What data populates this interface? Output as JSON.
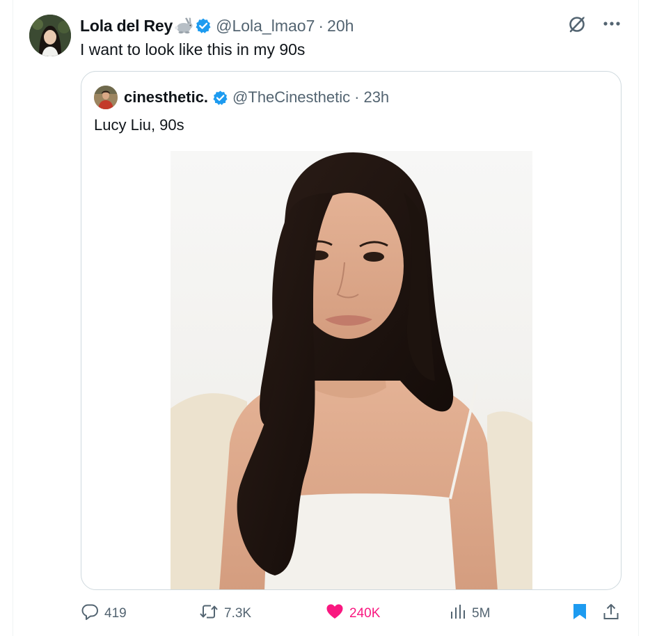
{
  "tweet": {
    "author": {
      "display_name": "Lola del Rey",
      "handle": "@Lola_lmao7",
      "avatar_icon": "avatar-photo"
    },
    "time": "20h",
    "separator": "·",
    "text": "I want to look like this in my 90s"
  },
  "quoted": {
    "author": {
      "display_name": "cinesthetic.",
      "handle": "@TheCinesthetic"
    },
    "separator": "·",
    "time": "23h",
    "text": "Lucy Liu, 90s"
  },
  "actions": {
    "replies": "419",
    "reposts": "7.3K",
    "likes": "240K",
    "views": "5M"
  },
  "colors": {
    "verified": "#1d9bf0",
    "like": "#f91880",
    "bookmark": "#1d9bf0",
    "muted": "#536471"
  }
}
